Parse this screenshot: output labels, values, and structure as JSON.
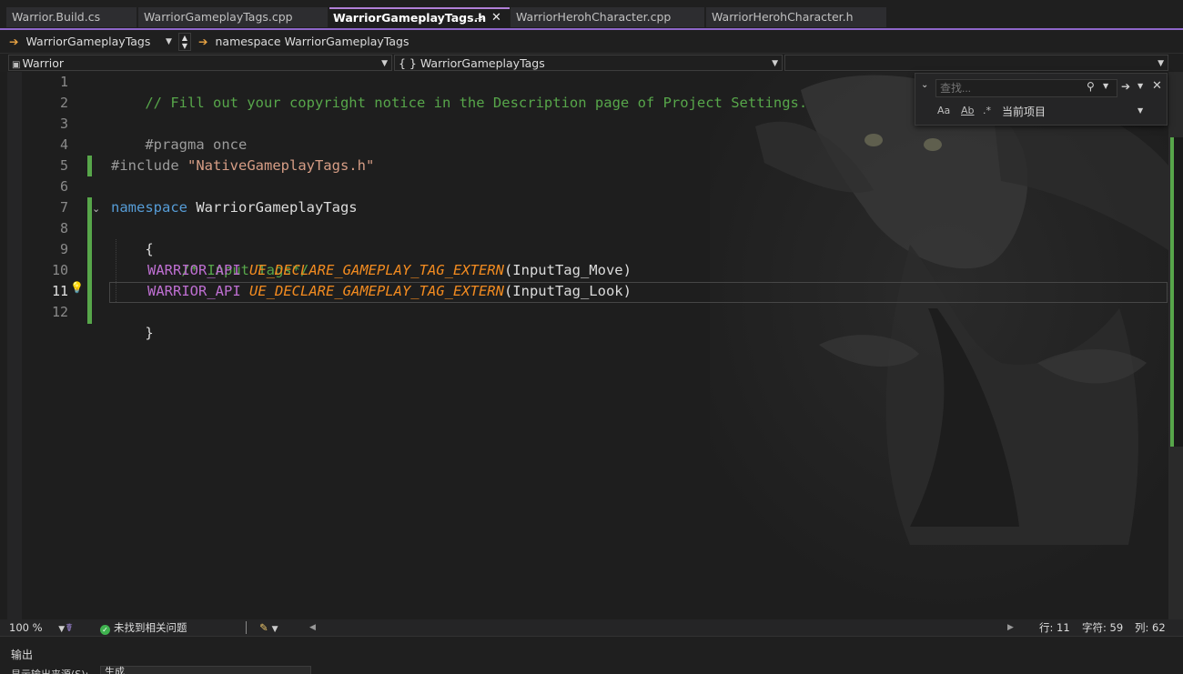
{
  "tabs": [
    {
      "label": "Warrior.Build.cs",
      "active": false
    },
    {
      "label": "WarriorGameplayTags.cpp",
      "active": false
    },
    {
      "label": "WarriorGameplayTags.h",
      "active": true
    },
    {
      "label": "WarriorHerohCharacter.cpp",
      "active": false
    },
    {
      "label": "WarriorHerohCharacter.h",
      "active": false
    }
  ],
  "active_tab_icons": {
    "pin": "pin-icon",
    "close": "close-icon"
  },
  "nav": {
    "scope_dropdown": "WarriorGameplayTags",
    "breadcrumb": "namespace WarriorGameplayTags"
  },
  "members": {
    "project": "Warrior",
    "scope": "{ } WarriorGameplayTags",
    "member": ""
  },
  "editor": {
    "lines": [
      {
        "num": "1"
      },
      {
        "num": "2"
      },
      {
        "num": "3"
      },
      {
        "num": "4"
      },
      {
        "num": "5"
      },
      {
        "num": "6"
      },
      {
        "num": "7"
      },
      {
        "num": "8"
      },
      {
        "num": "9"
      },
      {
        "num": "10"
      },
      {
        "num": "11"
      },
      {
        "num": "12"
      }
    ],
    "code": {
      "l1": "// Fill out your copyright notice in the Description page of Project Settings.",
      "l3": "#pragma once",
      "l5_pp": "#include ",
      "l5_str": "\"NativeGameplayTags.h\"",
      "l7_kw": "namespace",
      "l7_name": " WarriorGameplayTags",
      "l8": "{",
      "l9": "/* Input Tags*/",
      "l10_macro": "WARRIOR_API",
      "l10_fn": "UE_DECLARE_GAMEPLAY_TAG_EXTERN",
      "l10_args": "(InputTag_Move)",
      "l11_macro": "WARRIOR_API",
      "l11_fn": "UE_DECLARE_GAMEPLAY_TAG_EXTERN",
      "l11_args": "(InputTag_Look)",
      "l12": "}"
    },
    "current_line": 11
  },
  "find": {
    "placeholder": "查找...",
    "scope": "当前项目",
    "options": [
      "Aa",
      "Ab",
      ".*"
    ]
  },
  "status": {
    "zoom": "100 %",
    "issues": "未找到相关问题",
    "line": "行: 11",
    "char": "字符: 59",
    "col": "列: 62"
  },
  "output": {
    "title": "输出",
    "source_label": "显示输出来源(S):",
    "source_value": "生成"
  },
  "colors": {
    "accent": "#8e66c9",
    "comment": "#57a64a",
    "keyword": "#569cd6",
    "macro": "#be6fd1",
    "function": "#f28b20",
    "string": "#d69d85"
  }
}
